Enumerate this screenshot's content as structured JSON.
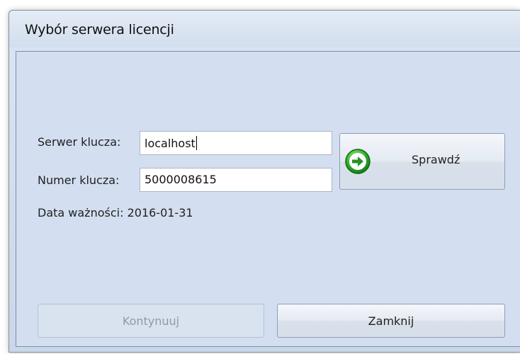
{
  "window": {
    "title": "Wybór serwera licencji"
  },
  "form": {
    "server_label": "Serwer klucza:",
    "server_value": "localhost",
    "number_label": "Numer klucza:",
    "number_value": "5000008615",
    "expiry_label": "Data ważności:",
    "expiry_value": "2016-01-31"
  },
  "buttons": {
    "check_label": "Sprawdź",
    "check_icon": "green-arrow-right-icon",
    "continue_label": "Kontynuuj",
    "continue_enabled": false,
    "close_label": "Zamknij"
  },
  "colors": {
    "check_icon_green": "#2fae2a",
    "disabled_text": "#8f9aa8"
  }
}
